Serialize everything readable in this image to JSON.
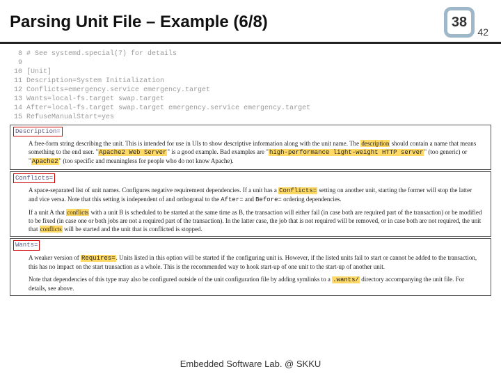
{
  "header": {
    "title": "Parsing Unit File – Example (6/8)",
    "page": "38",
    "subpage": "42"
  },
  "code": {
    "lines": [
      {
        "n": "8",
        "t": "# See systemd.special(7) for details"
      },
      {
        "n": "9",
        "t": ""
      },
      {
        "n": "10",
        "t": "[Unit]"
      },
      {
        "n": "11",
        "t": "Description=System Initialization"
      },
      {
        "n": "12",
        "t": "Conflicts=emergency.service emergency.target"
      },
      {
        "n": "13",
        "t": "Wants=local-fs.target swap.target"
      },
      {
        "n": "14",
        "t": "After=local-fs.target swap.target emergency.service emergency.target"
      },
      {
        "n": "15",
        "t": "RefuseManualStart=yes"
      }
    ]
  },
  "blocks": {
    "desc": {
      "label": "Description=",
      "p1a": "A free-form string describing the unit. This is intended for use in UIs to show descriptive information along with the unit name. The ",
      "p1h1": "description",
      "p1b": " should contain a name that means something to the end user. \"",
      "p1h2": "Apache2 Web Server",
      "p1c": "\" is a good example. Bad examples are \"",
      "p1h3": "high-performance light-weight HTTP server",
      "p1d": "\" (too generic) or \"",
      "p1h4": "Apache2",
      "p1e": "\" (too specific and meaningless for people who do not know Apache)."
    },
    "conf": {
      "label": "Conflicts=",
      "p1a": "A space-separated list of unit names. Configures negative requirement dependencies. If a unit has a ",
      "p1h1": "Conflicts=",
      "p1b": " setting on another unit, starting the former will stop the latter and vice versa. Note that this setting is independent of and orthogonal to the ",
      "p1m1": "After=",
      "p1c": " and ",
      "p1m2": "Before=",
      "p1d": " ordering dependencies.",
      "p2a": "If a unit A that ",
      "p2h1": "conflicts",
      "p2b": " with a unit B is scheduled to be started at the same time as B, the transaction will either fail (in case both are required part of the transaction) or be modified to be fixed (in case one or both jobs are not a required part of the transaction). In the latter case, the job that is not required will be removed, or in case both are not required, the unit that ",
      "p2h2": "conflicts",
      "p2c": " will be started and the unit that is conflicted is stopped."
    },
    "wants": {
      "label": "Wants=",
      "p1a": "A weaker version of ",
      "p1h1": "Requires=",
      "p1b": ". Units listed in this option will be started if the configuring unit is. However, if the listed units fail to start or cannot be added to the transaction, this has no impact on the start transaction as a whole. This is the recommended way to hook start-up of one unit to the start-up of another unit.",
      "p2a": "Note that dependencies of this type may also be configured outside of the unit configuration file by adding symlinks to a ",
      "p2h1": ".wants/",
      "p2b": " directory accompanying the unit file. For details, see above."
    }
  },
  "footer": {
    "text": "Embedded Software Lab. @ SKKU"
  }
}
